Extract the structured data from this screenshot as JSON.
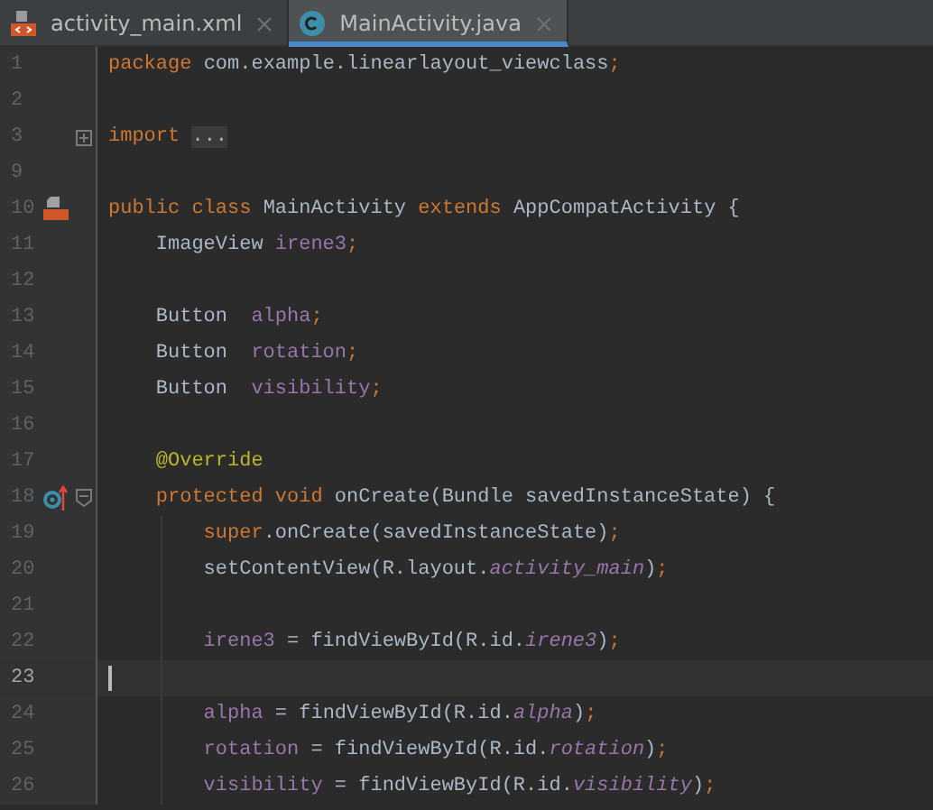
{
  "tabs": [
    {
      "label": "activity_main.xml",
      "kind": "xml",
      "selected": false
    },
    {
      "label": "MainActivity.java",
      "kind": "class",
      "selected": true
    }
  ],
  "editor": {
    "lines": [
      {
        "number": "1",
        "tokens": [
          {
            "kind": "keyword",
            "text": "package"
          },
          {
            "kind": "plain",
            "text": " com.example.linearlayout_viewclass"
          },
          {
            "kind": "keyword",
            "text": ";"
          }
        ]
      },
      {
        "number": "2"
      },
      {
        "number": "3",
        "fold": {
          "expanded": false
        },
        "tokens": [
          {
            "kind": "keyword",
            "text": "import "
          },
          {
            "kind": "folded",
            "text": "..."
          }
        ]
      },
      {
        "number": "9"
      },
      {
        "number": "10",
        "gutter_marker": {
          "kind": "class"
        },
        "tokens": [
          {
            "kind": "keyword",
            "text": "public class"
          },
          {
            "kind": "plain",
            "text": " MainActivity "
          },
          {
            "kind": "keyword",
            "text": "extends"
          },
          {
            "kind": "plain",
            "text": " AppCompatActivity {"
          }
        ],
        "children": [
          {
            "number": "11",
            "tokens": [
              {
                "kind": "plain",
                "text": "ImageView "
              },
              {
                "kind": "field",
                "text": "irene3"
              },
              {
                "kind": "keyword",
                "text": ";"
              }
            ]
          },
          {
            "number": "12"
          },
          {
            "number": "13",
            "tokens": [
              {
                "kind": "plain",
                "text": "Button  "
              },
              {
                "kind": "field",
                "text": "alpha"
              },
              {
                "kind": "keyword",
                "text": ";"
              }
            ]
          },
          {
            "number": "14",
            "tokens": [
              {
                "kind": "plain",
                "text": "Button  "
              },
              {
                "kind": "field",
                "text": "rotation"
              },
              {
                "kind": "keyword",
                "text": ";"
              }
            ]
          },
          {
            "number": "15",
            "tokens": [
              {
                "kind": "plain",
                "text": "Button  "
              },
              {
                "kind": "field",
                "text": "visibility"
              },
              {
                "kind": "keyword",
                "text": ";"
              }
            ]
          },
          {
            "number": "16"
          },
          {
            "number": "17",
            "tokens": [
              {
                "kind": "annotation",
                "text": "@Override"
              }
            ]
          },
          {
            "number": "18",
            "gutter_marker": {
              "kind": "override"
            },
            "fold": {
              "expanded": true
            },
            "tokens": [
              {
                "kind": "keyword",
                "text": "protected void"
              },
              {
                "kind": "plain",
                "text": " onCreate(Bundle savedInstanceState) {"
              }
            ],
            "children": [
              {
                "number": "19",
                "tokens": [
                  {
                    "kind": "keyword",
                    "text": "super"
                  },
                  {
                    "kind": "plain",
                    "text": ".onCreate(savedInstanceState)"
                  },
                  {
                    "kind": "keyword",
                    "text": ";"
                  }
                ]
              },
              {
                "number": "20",
                "tokens": [
                  {
                    "kind": "plain",
                    "text": "setContentView(R.layout."
                  },
                  {
                    "kind": "static",
                    "text": "activity_main"
                  },
                  {
                    "kind": "plain",
                    "text": ")"
                  },
                  {
                    "kind": "keyword",
                    "text": ";"
                  }
                ]
              },
              {
                "number": "21"
              },
              {
                "number": "22",
                "tokens": [
                  {
                    "kind": "field",
                    "text": "irene3"
                  },
                  {
                    "kind": "plain",
                    "text": " = findViewById(R.id."
                  },
                  {
                    "kind": "static",
                    "text": "irene3"
                  },
                  {
                    "kind": "plain",
                    "text": ")"
                  },
                  {
                    "kind": "keyword",
                    "text": ";"
                  }
                ]
              },
              {
                "number": "23",
                "current": true
              },
              {
                "number": "24",
                "tokens": [
                  {
                    "kind": "field",
                    "text": "alpha"
                  },
                  {
                    "kind": "plain",
                    "text": " = findViewById(R.id."
                  },
                  {
                    "kind": "static",
                    "text": "alpha"
                  },
                  {
                    "kind": "plain",
                    "text": ")"
                  },
                  {
                    "kind": "keyword",
                    "text": ";"
                  }
                ]
              },
              {
                "number": "25",
                "tokens": [
                  {
                    "kind": "field",
                    "text": "rotation"
                  },
                  {
                    "kind": "plain",
                    "text": " = findViewById(R.id."
                  },
                  {
                    "kind": "static",
                    "text": "rotation"
                  },
                  {
                    "kind": "plain",
                    "text": ")"
                  },
                  {
                    "kind": "keyword",
                    "text": ";"
                  }
                ]
              },
              {
                "number": "26",
                "tokens": [
                  {
                    "kind": "field",
                    "text": "visibility"
                  },
                  {
                    "kind": "plain",
                    "text": " = findViewById(R.id."
                  },
                  {
                    "kind": "static",
                    "text": "visibility"
                  },
                  {
                    "kind": "plain",
                    "text": ")"
                  },
                  {
                    "kind": "keyword",
                    "text": ";"
                  }
                ]
              }
            ]
          }
        ]
      }
    ]
  }
}
